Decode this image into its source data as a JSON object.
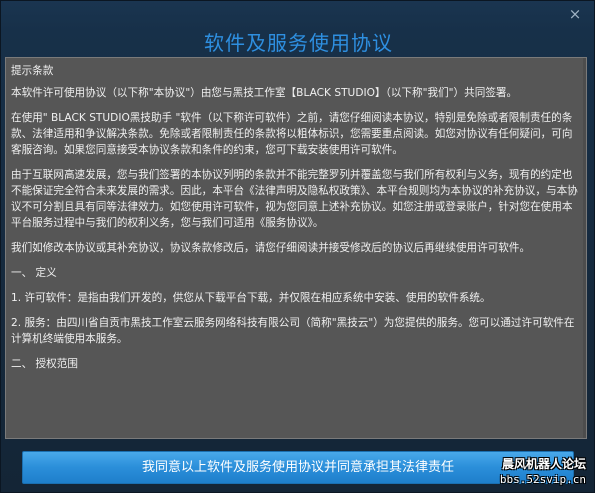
{
  "dialog": {
    "title": "软件及服务使用协议",
    "close_glyph": "×"
  },
  "agreement": {
    "paragraphs": [
      "提示条款",
      "本软件许可使用协议（以下称\"本协议\"）由您与黑技工作室【BLACK STUDIO】（以下称\"我们\"）共同签署。",
      "在使用\" BLACK STUDIO黑技助手 \"软件（以下称许可软件）之前，请您仔细阅读本协议，特别是免除或者限制责任的条款、法律适用和争议解决条款。免除或者限制责任的条款将以粗体标识，您需要重点阅读。如您对协议有任何疑问，可向客服咨询。如果您同意接受本协议条款和条件的约束，您可下载安装使用许可软件。",
      "由于互联网高速发展，您与我们签署的本协议列明的条款并不能完整罗列并覆盖您与我们所有权利与义务，现有的约定也不能保证完全符合未来发展的需求。因此，本平台《法律声明及隐私权政策》、本平台规则均为本协议的补充协议，与本协议不可分割且具有同等法律效力。如您使用许可软件，视为您同意上述补充协议。如您注册或登录账户，针对您在使用本平台服务过程中与我们的权利义务，您与我们可适用《服务协议》。",
      "我们如修改本协议或其补充协议，协议条款修改后，请您仔细阅读并接受修改后的协议后再继续使用许可软件。",
      "一、 定义",
      "1. 许可软件：是指由我们开发的，供您从下载平台下载，并仅限在相应系统中安装、使用的软件系统。",
      "2. 服务：由四川省自贡市黑技工作室云服务网络科技有限公司（简称\"黑技云\"）为您提供的服务。您可以通过许可软件在计算机终端使用本服务。",
      "二、 授权范围"
    ]
  },
  "agree_button": {
    "label": "我同意以上软件及服务使用协议并同意承担其法律责任"
  },
  "watermark": {
    "line1": "晨风机器人论坛",
    "line2": "bbs.52svip.cn"
  }
}
